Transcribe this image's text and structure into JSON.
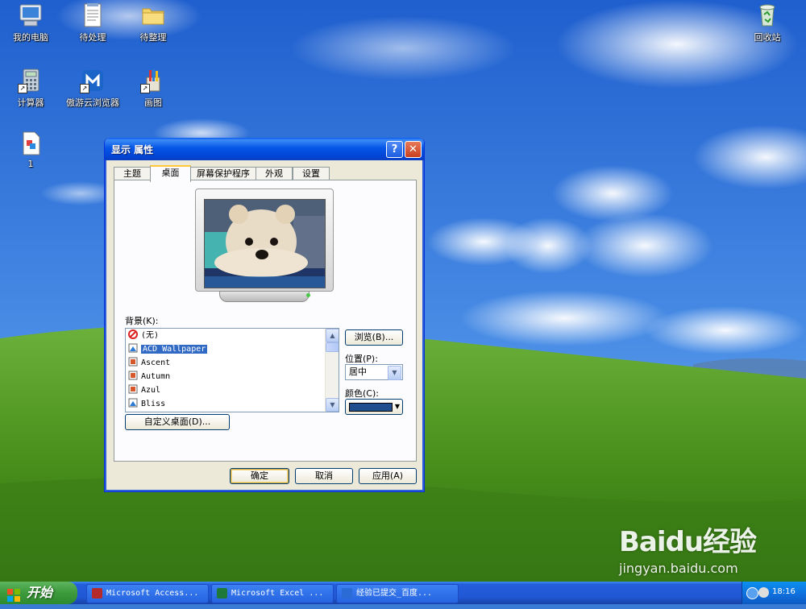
{
  "desktop": {
    "icons": [
      {
        "label": "我的电脑",
        "icon": "my-computer-icon"
      },
      {
        "label": "待处理",
        "icon": "notepad-icon"
      },
      {
        "label": "待整理",
        "icon": "folder-icon"
      },
      {
        "label": "回收站",
        "icon": "recycle-bin-icon"
      },
      {
        "label": "计算器",
        "icon": "calculator-icon"
      },
      {
        "label": "傲游云浏览器",
        "icon": "maxthon-browser-icon"
      },
      {
        "label": "画图",
        "icon": "paint-icon"
      },
      {
        "label": "1",
        "icon": "document-icon"
      }
    ]
  },
  "dialog": {
    "title": "显示 属性",
    "help_glyph": "?",
    "close_glyph": "✕",
    "tabs": [
      {
        "label": "主题"
      },
      {
        "label": "桌面",
        "active": true
      },
      {
        "label": "屏幕保护程序"
      },
      {
        "label": "外观"
      },
      {
        "label": "设置"
      }
    ],
    "background_label": "背景(K):",
    "backgrounds": [
      {
        "name": "(无)",
        "icon": "none-icon"
      },
      {
        "name": "ACD Wallpaper",
        "icon": "image-file-icon",
        "selected": true
      },
      {
        "name": "Ascent",
        "icon": "image-file-icon"
      },
      {
        "name": "Autumn",
        "icon": "image-file-icon"
      },
      {
        "name": "Azul",
        "icon": "image-file-icon"
      },
      {
        "name": "Bliss",
        "icon": "image-file-icon"
      }
    ],
    "browse_label": "浏览(B)...",
    "position_label": "位置(P):",
    "position_value": "居中",
    "color_label": "颜色(C):",
    "color_value": "#1f4f8f",
    "customize_label": "自定义桌面(D)...",
    "ok_label": "确定",
    "cancel_label": "取消",
    "apply_label": "应用(A)"
  },
  "taskbar": {
    "start_label": "开始",
    "buttons": [
      {
        "label": "Microsoft Access...",
        "icon": "access-icon",
        "color": "#b52a2a"
      },
      {
        "label": "Microsoft Excel ...",
        "icon": "excel-icon",
        "color": "#1f7a3a"
      },
      {
        "label": "经验已提交_百度...",
        "icon": "browser-icon",
        "color": "#2a6bd6"
      }
    ],
    "clock": "18:16"
  },
  "watermark": {
    "logo": "Baidu经验",
    "url": "jingyan.baidu.com"
  },
  "colors": {
    "sky": "#2d6fd8",
    "grass": "#4e9a1e",
    "selection": "#316ac5"
  }
}
